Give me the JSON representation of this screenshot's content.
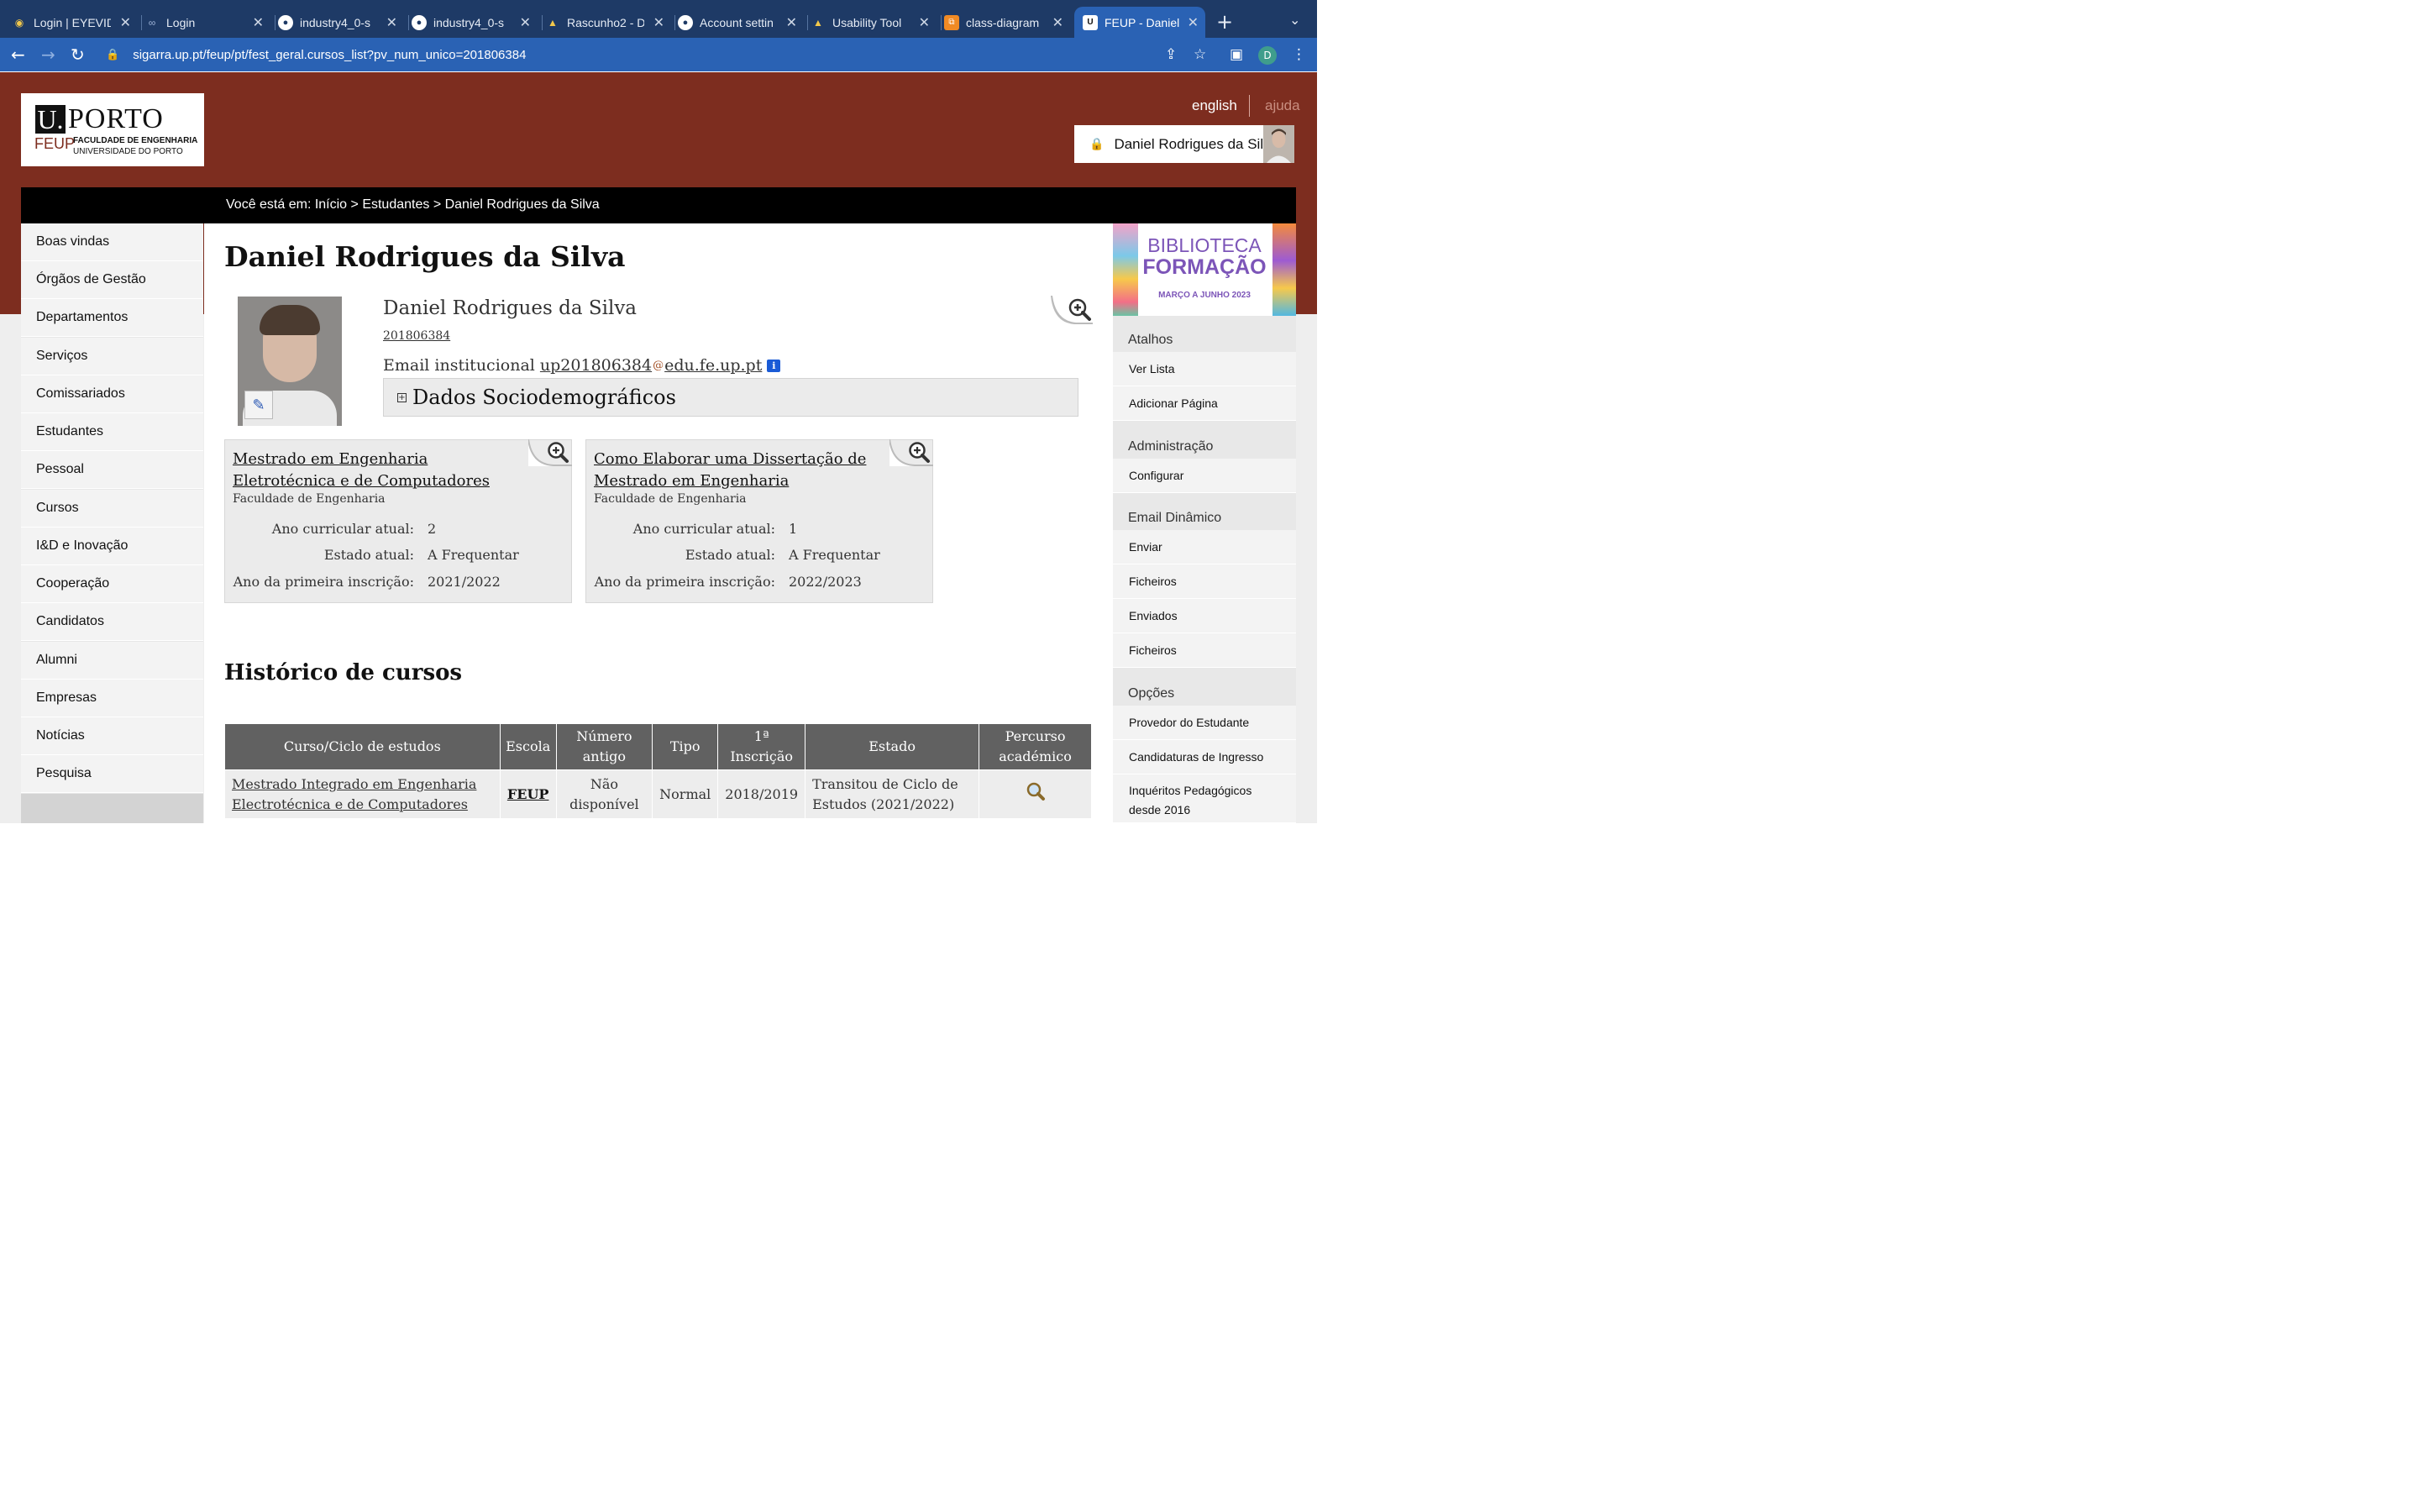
{
  "browser": {
    "tabs": [
      {
        "title": "Login | EYEVID",
        "favicon": "eye-favicon"
      },
      {
        "title": "Login",
        "favicon": "login-favicon"
      },
      {
        "title": "industry4_0-s",
        "favicon": "github-icon"
      },
      {
        "title": "industry4_0-s",
        "favicon": "github-icon"
      },
      {
        "title": "Rascunho2 - D",
        "favicon": "google-drive-icon"
      },
      {
        "title": "Account settin",
        "favicon": "github-icon"
      },
      {
        "title": "Usability Tool",
        "favicon": "google-drive-icon"
      },
      {
        "title": "class-diagram",
        "favicon": "diagram-icon"
      },
      {
        "title": "FEUP - Daniel",
        "favicon": "uporto-icon",
        "active": true
      }
    ],
    "url": "sigarra.up.pt/feup/pt/fest_geral.cursos_list?pv_num_unico=201806384",
    "profile_initial": "D"
  },
  "header": {
    "logo": {
      "u": "U.",
      "porto": "PORTO",
      "feup": "FEUP",
      "faculty": "FACULDADE DE ENGENHARIA",
      "university": "UNIVERSIDADE DO PORTO"
    },
    "lang_link": "english",
    "help_link": "ajuda",
    "user_name": "Daniel Rodrigues da Silva",
    "breadcrumb": "Você está em: Início > Estudantes > Daniel Rodrigues da Silva"
  },
  "leftnav": {
    "items": [
      "Boas vindas",
      "Órgãos de Gestão",
      "Departamentos",
      "Serviços",
      "Comissariados",
      "Estudantes",
      "Pessoal",
      "Cursos",
      "I&D e Inovação",
      "Cooperação",
      "Candidatos",
      "Alumni",
      "Empresas",
      "Notícias",
      "Pesquisa"
    ]
  },
  "main": {
    "title": "Daniel Rodrigues da Silva",
    "profile": {
      "name": "Daniel Rodrigues da Silva",
      "number": "201806384",
      "email_label": "Email institucional",
      "email_user": "up201806384",
      "email_domain": "edu.fe.up.pt",
      "info_icon_text": "i"
    },
    "socio_label": "Dados Sociodemográficos",
    "courses": [
      {
        "title": "Mestrado em Engenharia Eletrotécnica e de Computadores",
        "school": "Faculdade de Engenharia",
        "rows": [
          {
            "label": "Ano curricular atual:",
            "value": "2"
          },
          {
            "label": "Estado atual:",
            "value": "A Frequentar"
          },
          {
            "label": "Ano da primeira inscrição:",
            "value": "2021/2022"
          }
        ]
      },
      {
        "title": "Como Elaborar uma Dissertação de Mestrado em Engenharia",
        "school": "Faculdade de Engenharia",
        "rows": [
          {
            "label": "Ano curricular atual:",
            "value": "1"
          },
          {
            "label": "Estado atual:",
            "value": "A Frequentar"
          },
          {
            "label": "Ano da primeira inscrição:",
            "value": "2022/2023"
          }
        ]
      }
    ],
    "history": {
      "title": "Histórico de cursos",
      "columns": [
        "Curso/Ciclo de estudos",
        "Escola",
        "Número antigo",
        "Tipo",
        "1ª Inscrição",
        "Estado",
        "Percurso académico"
      ],
      "rows": [
        {
          "course": "Mestrado Integrado em Engenharia Electrotécnica e de Computadores",
          "school": "FEUP",
          "old_number": "Não disponível",
          "type": "Normal",
          "first_enrollment": "2018/2019",
          "status": "Transitou de Ciclo de Estudos (2021/2022)"
        }
      ]
    }
  },
  "rightbar": {
    "banner": {
      "line1": "BIBLIOTECA",
      "line2": "FORMAÇÃO",
      "line3": "MARÇO A JUNHO 2023"
    },
    "sections": [
      {
        "heading": "Atalhos",
        "items": [
          "Ver Lista",
          "Adicionar Página"
        ]
      },
      {
        "heading": "Administração",
        "items": [
          "Configurar"
        ]
      },
      {
        "heading": "Email Dinâmico",
        "items": [
          "Enviar",
          "Ficheiros",
          "Enviados",
          "Ficheiros"
        ]
      },
      {
        "heading": "Opções",
        "items": [
          "Provedor do Estudante",
          "Candidaturas de Ingresso",
          "Inquéritos Pedagógicos desde 2016"
        ]
      }
    ]
  },
  "colors": {
    "brand": "#7d2d1f",
    "tab_active": "#2a62b4",
    "table_header": "#616161"
  }
}
